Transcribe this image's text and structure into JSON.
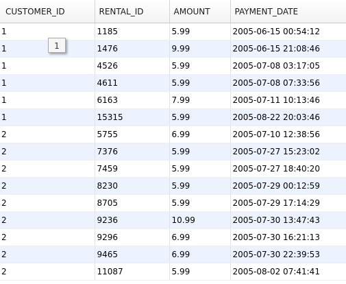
{
  "grid": {
    "columns": [
      "CUSTOMER_ID",
      "RENTAL_ID",
      "AMOUNT",
      "PAYMENT_DATE"
    ],
    "rows": [
      [
        "1",
        "1185",
        "5.99",
        "2005-06-15 00:54:12"
      ],
      [
        "1",
        "1476",
        "9.99",
        "2005-06-15 21:08:46"
      ],
      [
        "1",
        "4526",
        "5.99",
        "2005-07-08 03:17:05"
      ],
      [
        "1",
        "4611",
        "5.99",
        "2005-07-08 07:33:56"
      ],
      [
        "1",
        "6163",
        "7.99",
        "2005-07-11 10:13:46"
      ],
      [
        "1",
        "15315",
        "5.99",
        "2005-08-22 20:03:46"
      ],
      [
        "2",
        "5755",
        "6.99",
        "2005-07-10 12:38:56"
      ],
      [
        "2",
        "7376",
        "5.99",
        "2005-07-27 15:23:02"
      ],
      [
        "2",
        "7459",
        "5.99",
        "2005-07-27 18:40:20"
      ],
      [
        "2",
        "8230",
        "5.99",
        "2005-07-29 00:12:59"
      ],
      [
        "2",
        "8705",
        "5.99",
        "2005-07-29 17:14:29"
      ],
      [
        "2",
        "9236",
        "10.99",
        "2005-07-30 13:47:43"
      ],
      [
        "2",
        "9296",
        "6.99",
        "2005-07-30 16:21:13"
      ],
      [
        "2",
        "9465",
        "6.99",
        "2005-07-30 22:39:53"
      ],
      [
        "2",
        "11087",
        "5.99",
        "2005-08-02 07:41:41"
      ]
    ]
  },
  "tooltip": {
    "text": "1"
  },
  "colors": {
    "row_alt": "#edf3fe",
    "row": "#ffffff",
    "header": "#f3f3f3"
  }
}
